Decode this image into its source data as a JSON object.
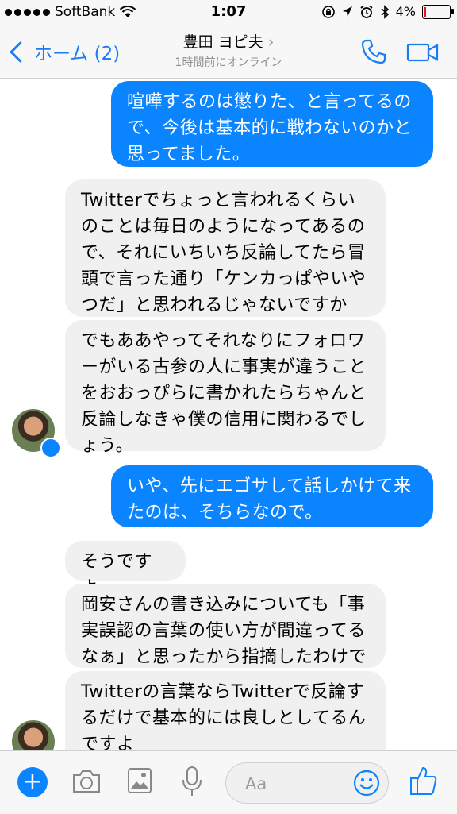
{
  "status_bar": {
    "carrier": "SoftBank",
    "time": "1:07",
    "battery_percent": "4%",
    "battery_level": 0.04
  },
  "nav": {
    "back_label": "ホーム (2)",
    "contact_name": "豊田 ヨピ夫",
    "contact_status": "1時間前にオンライン",
    "call_icon": "phone-icon",
    "video_icon": "video-camera-icon"
  },
  "messages": [
    {
      "direction": "out",
      "text": "喧嘩するのは懲りた、と言ってるの\nで、今後は基本的に戦わないのかと\n思ってました。"
    },
    {
      "direction": "in",
      "text": "Twitterでちょっと言われるくらい\nのことは毎日のようになってあるの\nで、それにいちいち反論してたら冒\n頭で言った通り「ケンカっぱやいや\nつだ」と思われるじゃないですか"
    },
    {
      "direction": "in",
      "text": "でもああやってそれなりにフォロワ\nーがいる古参の人に事実が違うこと\nをおおっぴらに書かれたらちゃんと\n反論しなきゃ僕の信用に関わるでし\nょう。"
    },
    {
      "direction": "out",
      "text": "いや、先にエゴサして話しかけて来\nたのは、そちらなので。"
    },
    {
      "direction": "in",
      "text": "そうですよ"
    },
    {
      "direction": "in",
      "text": "岡安さんの書き込みについても「事\n実誤認の言葉の使い方が間違ってる\nなぁ」と思ったから指摘したわけで"
    },
    {
      "direction": "in",
      "text": "Twitterの言葉ならTwitterで反論す\nるだけで基本的には良しとしてるん\nですよ"
    }
  ],
  "composer": {
    "placeholder": "Aa",
    "icons": [
      "plus-icon",
      "camera-icon",
      "image-icon",
      "microphone-icon",
      "emoji-icon",
      "thumbs-up-icon"
    ]
  },
  "colors": {
    "accent": "#0a84ff",
    "incoming_bubble": "#f1f0f0",
    "bar_bg": "#f7f7f7"
  }
}
